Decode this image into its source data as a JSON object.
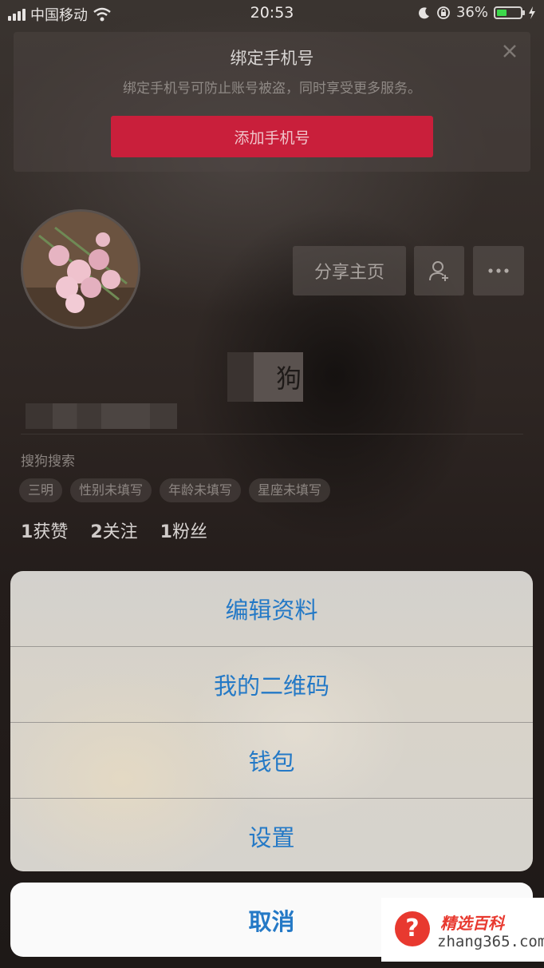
{
  "status_bar": {
    "carrier": "中国移动",
    "time": "20:53",
    "battery_percent": "36%",
    "icons": [
      "signal-icon",
      "wifi-icon",
      "moon-icon",
      "orientation-lock-icon",
      "battery-icon",
      "charging-icon"
    ]
  },
  "bind_phone": {
    "title": "绑定手机号",
    "description": "绑定手机号可防止账号被盗，同时享受更多服务。",
    "button_label": "添加手机号",
    "close_icon": "close-icon",
    "button_color": "#c91f3b"
  },
  "profile": {
    "share_label": "分享主页",
    "add_friend_icon": "add-user-icon",
    "more_icon": "more-icon",
    "name_partial": "狗",
    "signature": "搜狗搜索",
    "tags": [
      "三明",
      "性别未填写",
      "年龄未填写",
      "星座未填写"
    ],
    "stats": [
      {
        "count": "1",
        "label": "获赞"
      },
      {
        "count": "2",
        "label": "关注"
      },
      {
        "count": "1",
        "label": "粉丝"
      }
    ]
  },
  "action_sheet": {
    "items": [
      "编辑资料",
      "我的二维码",
      "钱包",
      "设置"
    ],
    "cancel_label": "取消",
    "accent_color": "#2479c6"
  },
  "watermark": {
    "brand": "精选百科",
    "url": "zhang365.com"
  }
}
